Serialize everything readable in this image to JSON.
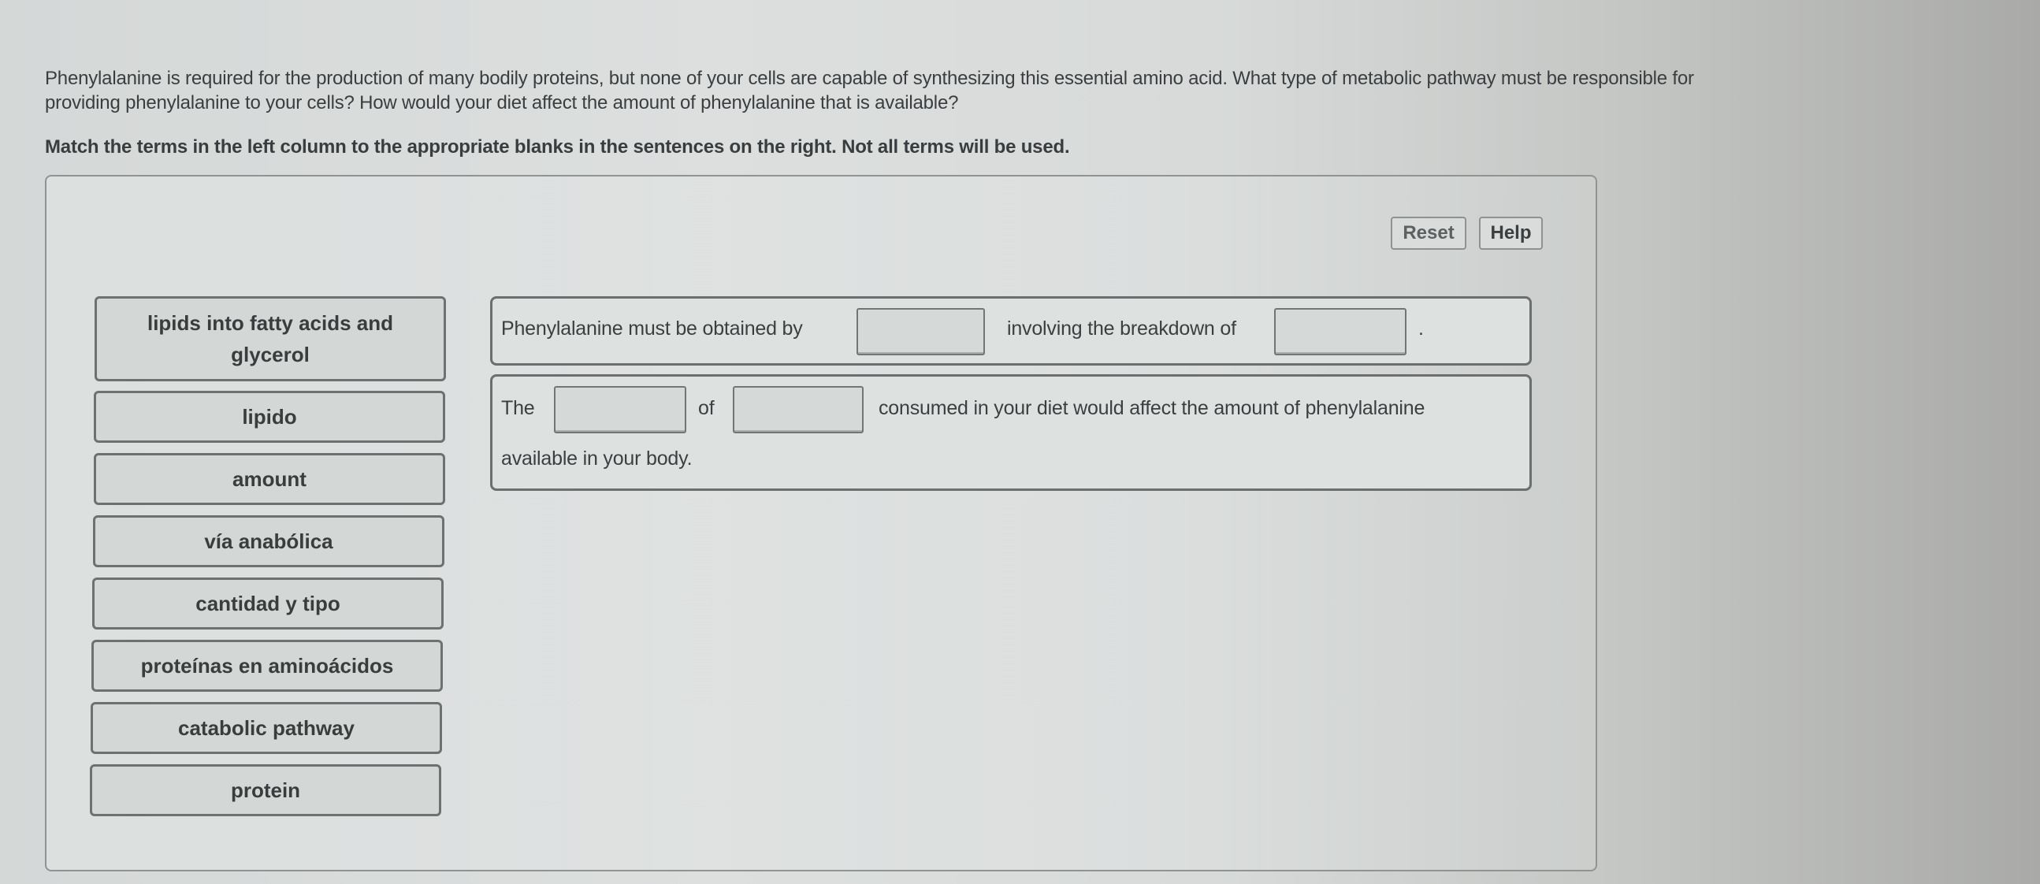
{
  "question": {
    "line1": "Phenylalanine is required for the production of many bodily proteins, but none of your cells are capable of synthesizing this essential amino acid. What type of metabolic pathway must be responsible for",
    "line2": "providing phenylalanine to your cells? How would your diet affect the amount of phenylalanine that is available?"
  },
  "instruction": "Match the terms in the left column to the appropriate blanks in the sentences on the right. Not all terms will be used.",
  "toolbar": {
    "reset_label": "Reset",
    "help_label": "Help"
  },
  "terms": [
    {
      "label": "lipids into fatty acids and glycerol"
    },
    {
      "label": "lipido"
    },
    {
      "label": "amount"
    },
    {
      "label": "vía anabólica"
    },
    {
      "label": "cantidad y tipo"
    },
    {
      "label": "proteínas en aminoácidos"
    },
    {
      "label": "catabolic pathway"
    },
    {
      "label": "protein"
    }
  ],
  "sentences": [
    {
      "part1": "Phenylalanine must be obtained by",
      "blank1": "",
      "part2": "involving the breakdown of",
      "blank2": "",
      "part3": "."
    },
    {
      "part1": "The",
      "blank1": "",
      "part2": "of",
      "blank2": "",
      "part3": "consumed in your diet would affect the amount of phenylalanine",
      "part4": "available in your body."
    }
  ]
}
